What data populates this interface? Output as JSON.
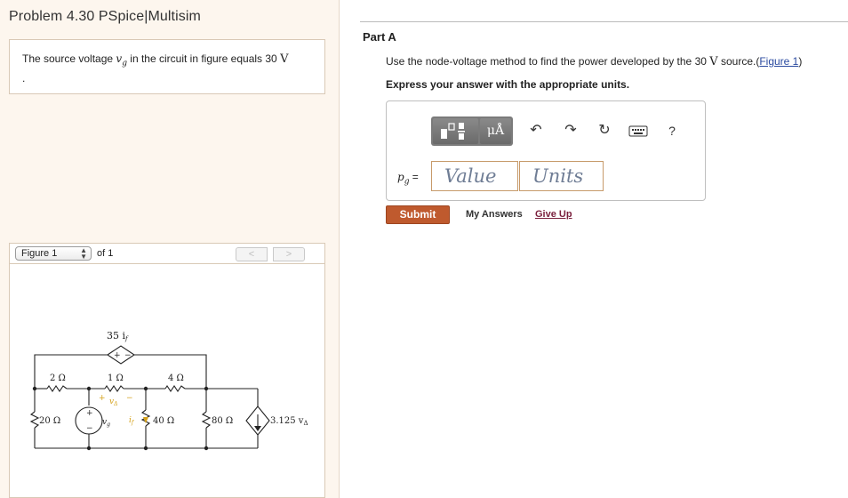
{
  "problem": {
    "title": "Problem 4.30 PSpice|Multisim",
    "statement_pre": "The source voltage ",
    "statement_var": "v",
    "statement_var_sub": "g",
    "statement_mid": " in the circuit in figure equals 30 ",
    "statement_unit": "V",
    "statement_end": "."
  },
  "figure_nav": {
    "select_value": "Figure 1",
    "of_text": "of 1",
    "prev": "<",
    "next": ">"
  },
  "circuit": {
    "dep_vsource_label": "35 i",
    "dep_vsource_sub": "f",
    "r_top1": "2 Ω",
    "r_top2": "1 Ω",
    "r_top3": "4 Ω",
    "r_left": "20 Ω",
    "r_mid": "40 Ω",
    "r_right": "80 Ω",
    "dep_isource_label": "3.125 v",
    "dep_isource_sub": "Δ",
    "vg_label": "v",
    "vg_sub": "g",
    "if_label": "i",
    "if_sub": "f",
    "vdelta_label": "v",
    "vdelta_sub": "Δ",
    "plus": "+",
    "minus": "−"
  },
  "part_a": {
    "title": "Part A",
    "instruction_pre": "Use the node-voltage method to find the power developed by the 30 ",
    "instruction_unit": "V",
    "instruction_post": " source.(",
    "figure_link": "Figure 1",
    "instruction_close": ")",
    "express": "Express your answer with the appropriate units.",
    "answer_label": "p",
    "answer_label_sub": "g",
    "answer_equals": " =",
    "value_placeholder": "Value",
    "units_placeholder": "Units",
    "units_button": "μÅ",
    "help": "?",
    "submit": "Submit",
    "my_answers": "My Answers",
    "give_up": "Give Up"
  },
  "colors": {
    "panel_bg": "#fdf6ee",
    "submit": "#bf5a2e",
    "link": "#2a4aa0",
    "give_up": "#7a1f3c",
    "accent_yellow": "#d4a017"
  }
}
